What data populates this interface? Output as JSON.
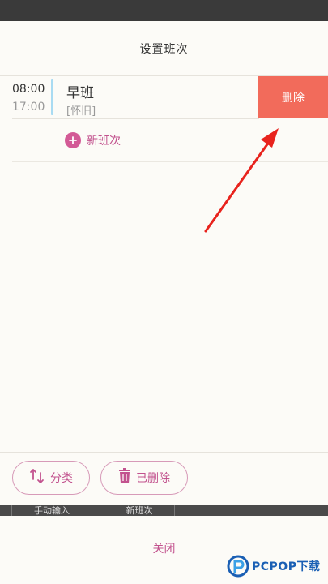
{
  "dialog": {
    "title": "设置班次",
    "shift": {
      "start_time": "08:00",
      "end_time": "17:00",
      "name": "早班",
      "note": "[怀旧]",
      "delete_label": "删除"
    },
    "new_shift_label": "新班次"
  },
  "bottom": {
    "sort_label": "分类",
    "deleted_label": "已删除"
  },
  "underlay": {
    "manual_input": "手动输入",
    "new_shift": "新班次"
  },
  "close_label": "关闭",
  "watermark": {
    "text": "PCPOP下载"
  },
  "icons": [
    "plus-circle-icon",
    "sort-arrows-icon",
    "trash-icon",
    "red-arrow-annotation"
  ],
  "colors": {
    "accent": "#c2528e",
    "delete": "#f26b5b",
    "shift_bar": "#a9dbf2"
  }
}
